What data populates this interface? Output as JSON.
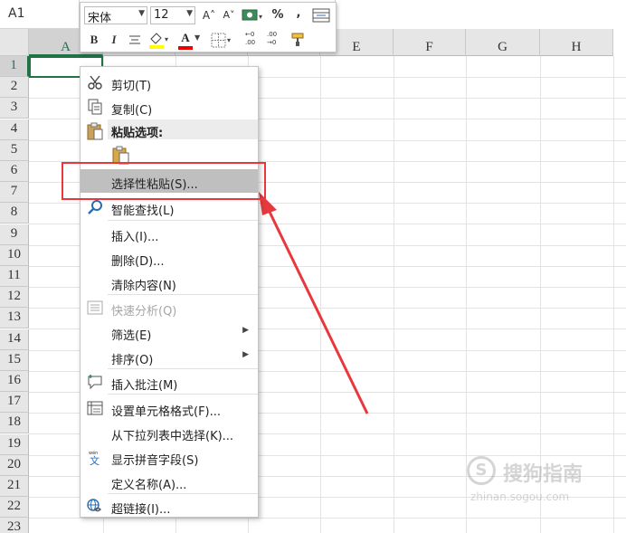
{
  "name_box": {
    "value": "A1"
  },
  "columns": [
    "A",
    "B",
    "C",
    "D",
    "E",
    "F",
    "G",
    "H"
  ],
  "rows": [
    "1",
    "2",
    "3",
    "4",
    "5",
    "6",
    "7",
    "8",
    "9",
    "10",
    "11",
    "12",
    "13",
    "14",
    "15",
    "16",
    "17",
    "18",
    "19",
    "20",
    "21",
    "22",
    "23"
  ],
  "mini_toolbar": {
    "font": "宋体",
    "size": "12",
    "grow_font": "A˄",
    "shrink_font": "A˅",
    "percent": "%",
    "comma": ",",
    "bold": "B",
    "italic": "I",
    "font_color_letter": "A",
    "inc_decimal": "←0 .00",
    "dec_decimal": ".00 →0"
  },
  "context_menu": {
    "cut": "剪切(T)",
    "copy": "复制(C)",
    "paste_options": "粘贴选项:",
    "paste_special": "选择性粘贴(S)...",
    "smart_lookup": "智能查找(L)",
    "insert": "插入(I)...",
    "delete": "删除(D)...",
    "clear": "清除内容(N)",
    "quick_analysis": "快速分析(Q)",
    "filter": "筛选(E)",
    "sort": "排序(O)",
    "insert_comment": "插入批注(M)",
    "format_cells": "设置单元格格式(F)...",
    "pick_from_list": "从下拉列表中选择(K)...",
    "phonetic": "显示拼音字段(S)",
    "define_name": "定义名称(A)...",
    "hyperlink": "超链接(I)..."
  },
  "watermark": {
    "text": "搜狗指南",
    "url": "zhinan.sogou.com"
  },
  "colors": {
    "accent": "#217346",
    "highlight": "#e8383d"
  },
  "icons": [
    "scissors-icon",
    "copy-icon",
    "clipboard-icon",
    "paste-icon",
    "smart-lookup-icon",
    "quick-analysis-icon",
    "comment-icon",
    "format-cells-icon",
    "phonetic-icon",
    "hyperlink-icon"
  ]
}
